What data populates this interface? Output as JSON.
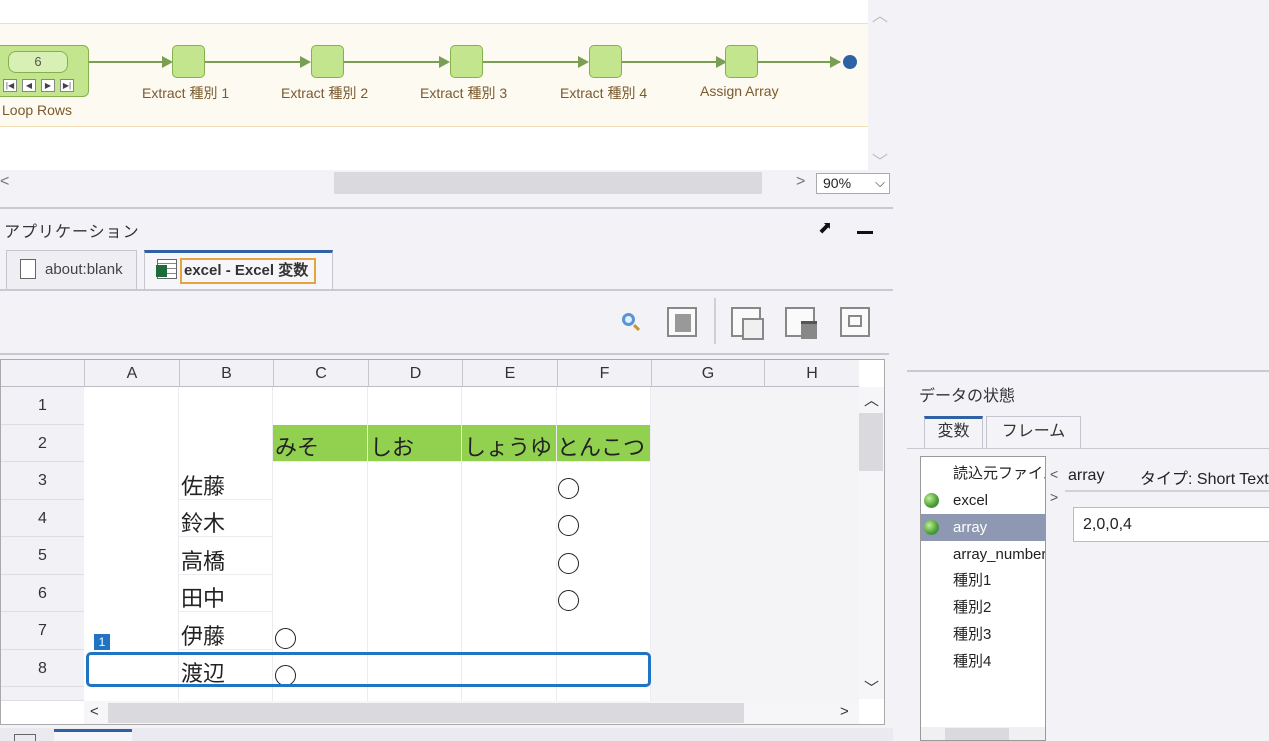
{
  "workflow": {
    "loop": {
      "count": "6",
      "label": "Loop Rows"
    },
    "steps": [
      {
        "label": "Extract 種別 1"
      },
      {
        "label": "Extract 種別 2"
      },
      {
        "label": "Extract 種別 3"
      },
      {
        "label": "Extract 種別 4"
      },
      {
        "label": "Assign Array"
      }
    ],
    "zoom": "90%"
  },
  "application": {
    "title": "アプリケーション",
    "tabs": [
      {
        "label": "about:blank"
      },
      {
        "label": "excel - Excel 変数"
      }
    ]
  },
  "sheet": {
    "columns": [
      "A",
      "B",
      "C",
      "D",
      "E",
      "F",
      "G",
      "H"
    ],
    "rows": [
      "1",
      "2",
      "3",
      "4",
      "5",
      "6",
      "7",
      "8"
    ],
    "headers": [
      "みそ",
      "しお",
      "しょうゆ",
      "とんこつ"
    ],
    "names": [
      "佐藤",
      "鈴木",
      "高橋",
      "田中",
      "伊藤",
      "渡辺"
    ],
    "selection_badge": "1",
    "header_color": "#92d050",
    "selection_color": "#1f74c4"
  },
  "state_panel": {
    "title": "データの状態",
    "tabs": [
      "変数",
      "フレーム"
    ],
    "variables": [
      {
        "name": "読込元ファイル"
      },
      {
        "name": "excel"
      },
      {
        "name": "array"
      },
      {
        "name": "array_number"
      },
      {
        "name": "種別1"
      },
      {
        "name": "種別2"
      },
      {
        "name": "種別3"
      },
      {
        "name": "種別4"
      }
    ],
    "selected": {
      "name": "array",
      "type": "タイプ: Short Text",
      "value": "2,0,0,4"
    }
  }
}
